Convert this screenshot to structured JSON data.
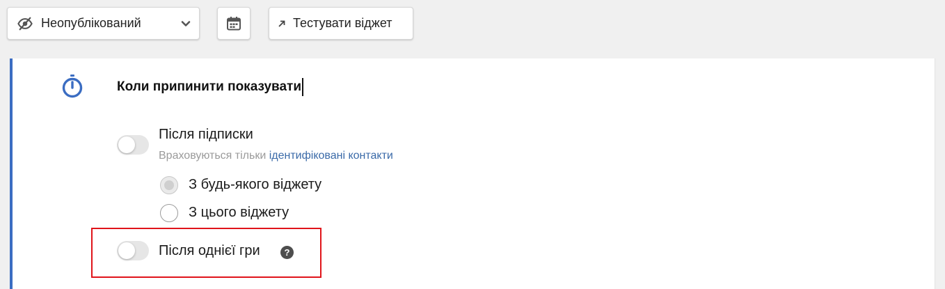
{
  "toolbar": {
    "status": {
      "label": "Неопубліковaний",
      "icon": "eye-off-icon",
      "dropdown_icon": "chevron-down-icon"
    },
    "calendar": {
      "icon": "calendar-icon"
    },
    "test_widget": {
      "label": "Тестувати віджет",
      "icon": "arrow-up-right-icon"
    }
  },
  "section": {
    "icon": "stopwatch-icon",
    "title": "Коли припинити показувати",
    "accent_color": "#3b6dc2",
    "options": [
      {
        "label": "Після підписки",
        "enabled": false,
        "hint_prefix": "Враховуються тільки ",
        "hint_link": "ідентифіковані контакти",
        "radios": [
          {
            "label": "З будь-якого віджету",
            "selected": true
          },
          {
            "label": "З цього віджету",
            "selected": false
          }
        ]
      },
      {
        "label": "Після однієї гри",
        "enabled": false,
        "help_icon": "question-circle-icon",
        "help_glyph": "?",
        "highlight_color": "#e0141a"
      }
    ]
  }
}
